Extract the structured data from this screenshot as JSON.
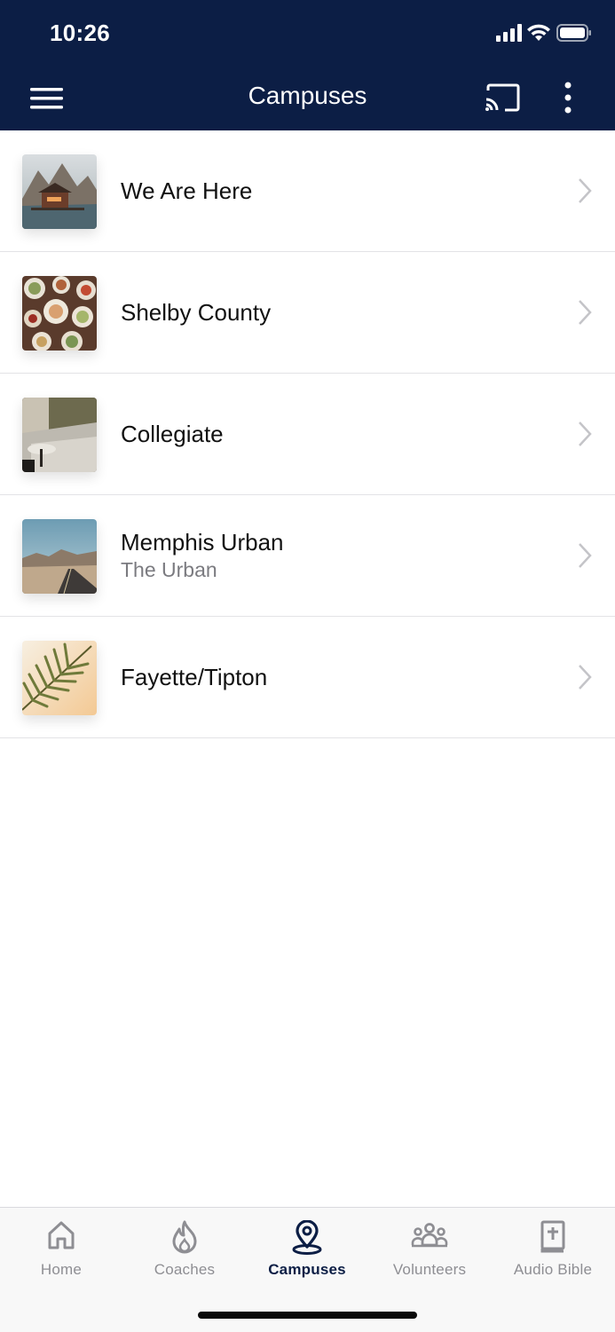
{
  "status_bar": {
    "time": "10:26"
  },
  "header": {
    "title": "Campuses",
    "menu_icon": "hamburger-icon",
    "cast_icon": "cast-icon",
    "more_icon": "more-vertical-icon"
  },
  "campuses": [
    {
      "title": "We Are Here",
      "subtitle": "",
      "thumbnail": "lake-cabin-mountains"
    },
    {
      "title": "Shelby County",
      "subtitle": "",
      "thumbnail": "food-table"
    },
    {
      "title": "Collegiate",
      "subtitle": "",
      "thumbnail": "living-room-rug"
    },
    {
      "title": "Memphis Urban",
      "subtitle": "The Urban",
      "thumbnail": "desert-road"
    },
    {
      "title": "Fayette/Tipton",
      "subtitle": "",
      "thumbnail": "palm-leaf"
    }
  ],
  "tabs": [
    {
      "label": "Home",
      "icon": "home-icon",
      "active": false
    },
    {
      "label": "Coaches",
      "icon": "flame-icon",
      "active": false
    },
    {
      "label": "Campuses",
      "icon": "location-pin-icon",
      "active": true
    },
    {
      "label": "Volunteers",
      "icon": "group-icon",
      "active": false
    },
    {
      "label": "Audio Bible",
      "icon": "bible-icon",
      "active": false
    }
  ],
  "colors": {
    "header_bg": "#0c1e45",
    "active_tab": "#0c1e45",
    "inactive_tab": "#8e8e93"
  }
}
